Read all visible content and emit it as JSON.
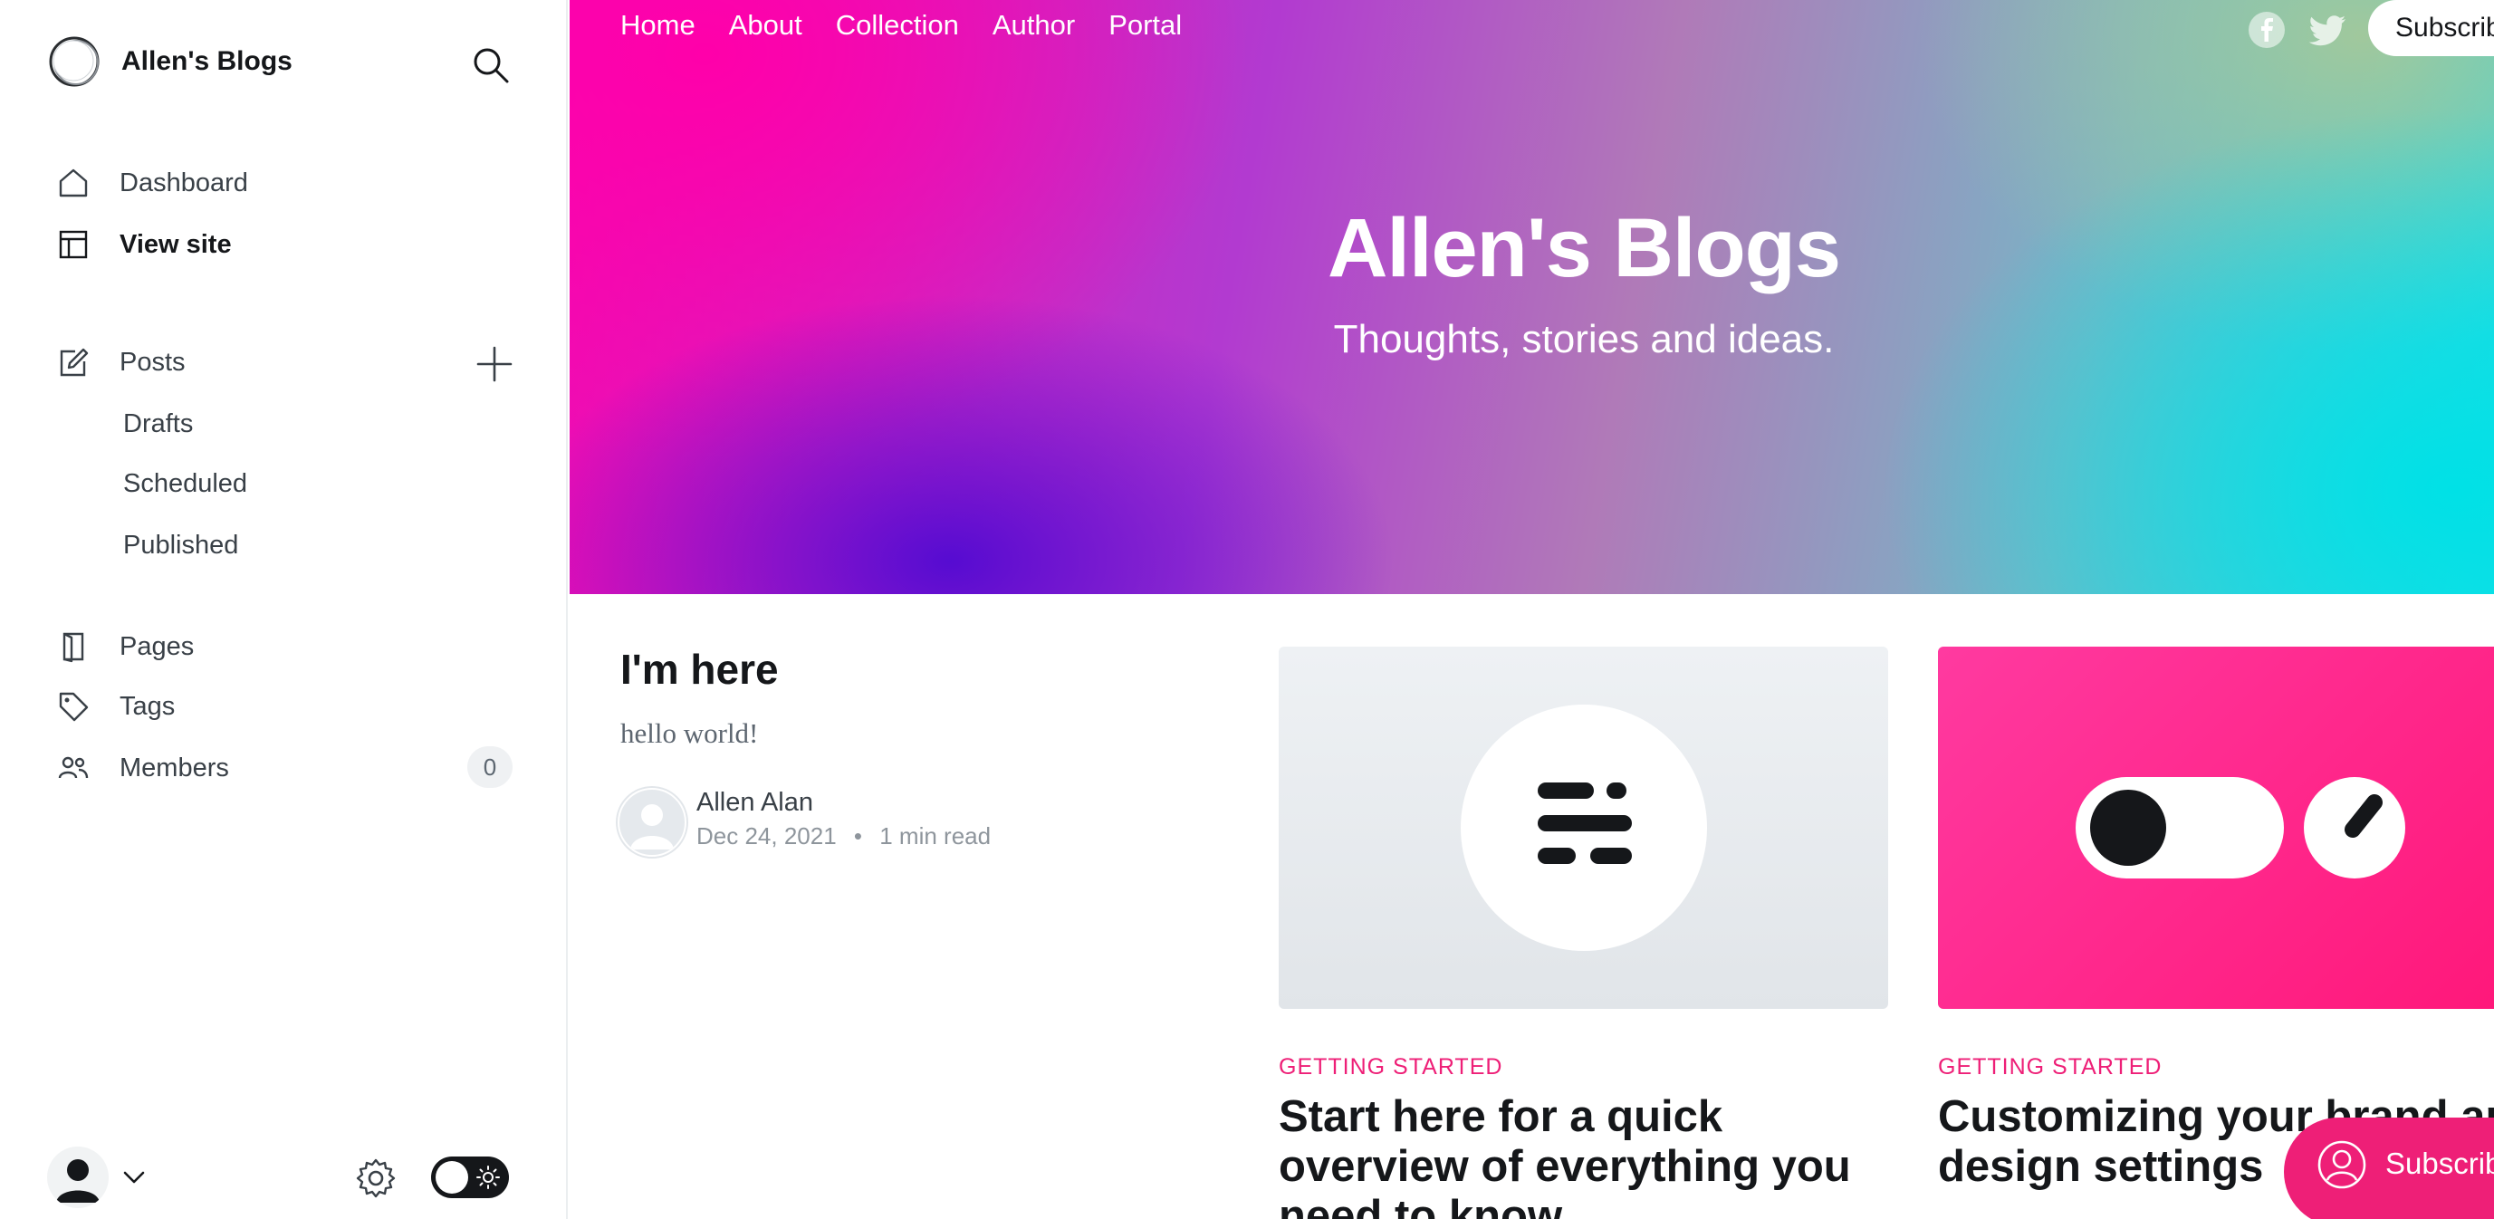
{
  "sidebar": {
    "brand_title": "Allen's Blogs",
    "nav": {
      "dashboard": "Dashboard",
      "view_site": "View site",
      "posts": "Posts",
      "drafts": "Drafts",
      "scheduled": "Scheduled",
      "published": "Published",
      "pages": "Pages",
      "tags": "Tags",
      "members": "Members",
      "members_count": "0"
    }
  },
  "site": {
    "nav": [
      "Home",
      "About",
      "Collection",
      "Author",
      "Portal"
    ],
    "subscribe_top": "Subscribe",
    "hero_title": "Allen's Blogs",
    "hero_subtitle": "Thoughts, stories and ideas.",
    "featured_post": {
      "title": "I'm here",
      "excerpt": "hello world!",
      "author": "Allen Alan",
      "date": "Dec 24, 2021",
      "read_time": "1 min read"
    },
    "cards": [
      {
        "tag": "GETTING STARTED",
        "title": "Start here for a quick overview of everything you need to know"
      },
      {
        "tag": "GETTING STARTED",
        "title": "Customizing your brand and design settings"
      }
    ],
    "fab_subscribe": "Subscribe"
  },
  "colors": {
    "accent": "#ee1f77",
    "sidebar_text": "#394047"
  }
}
